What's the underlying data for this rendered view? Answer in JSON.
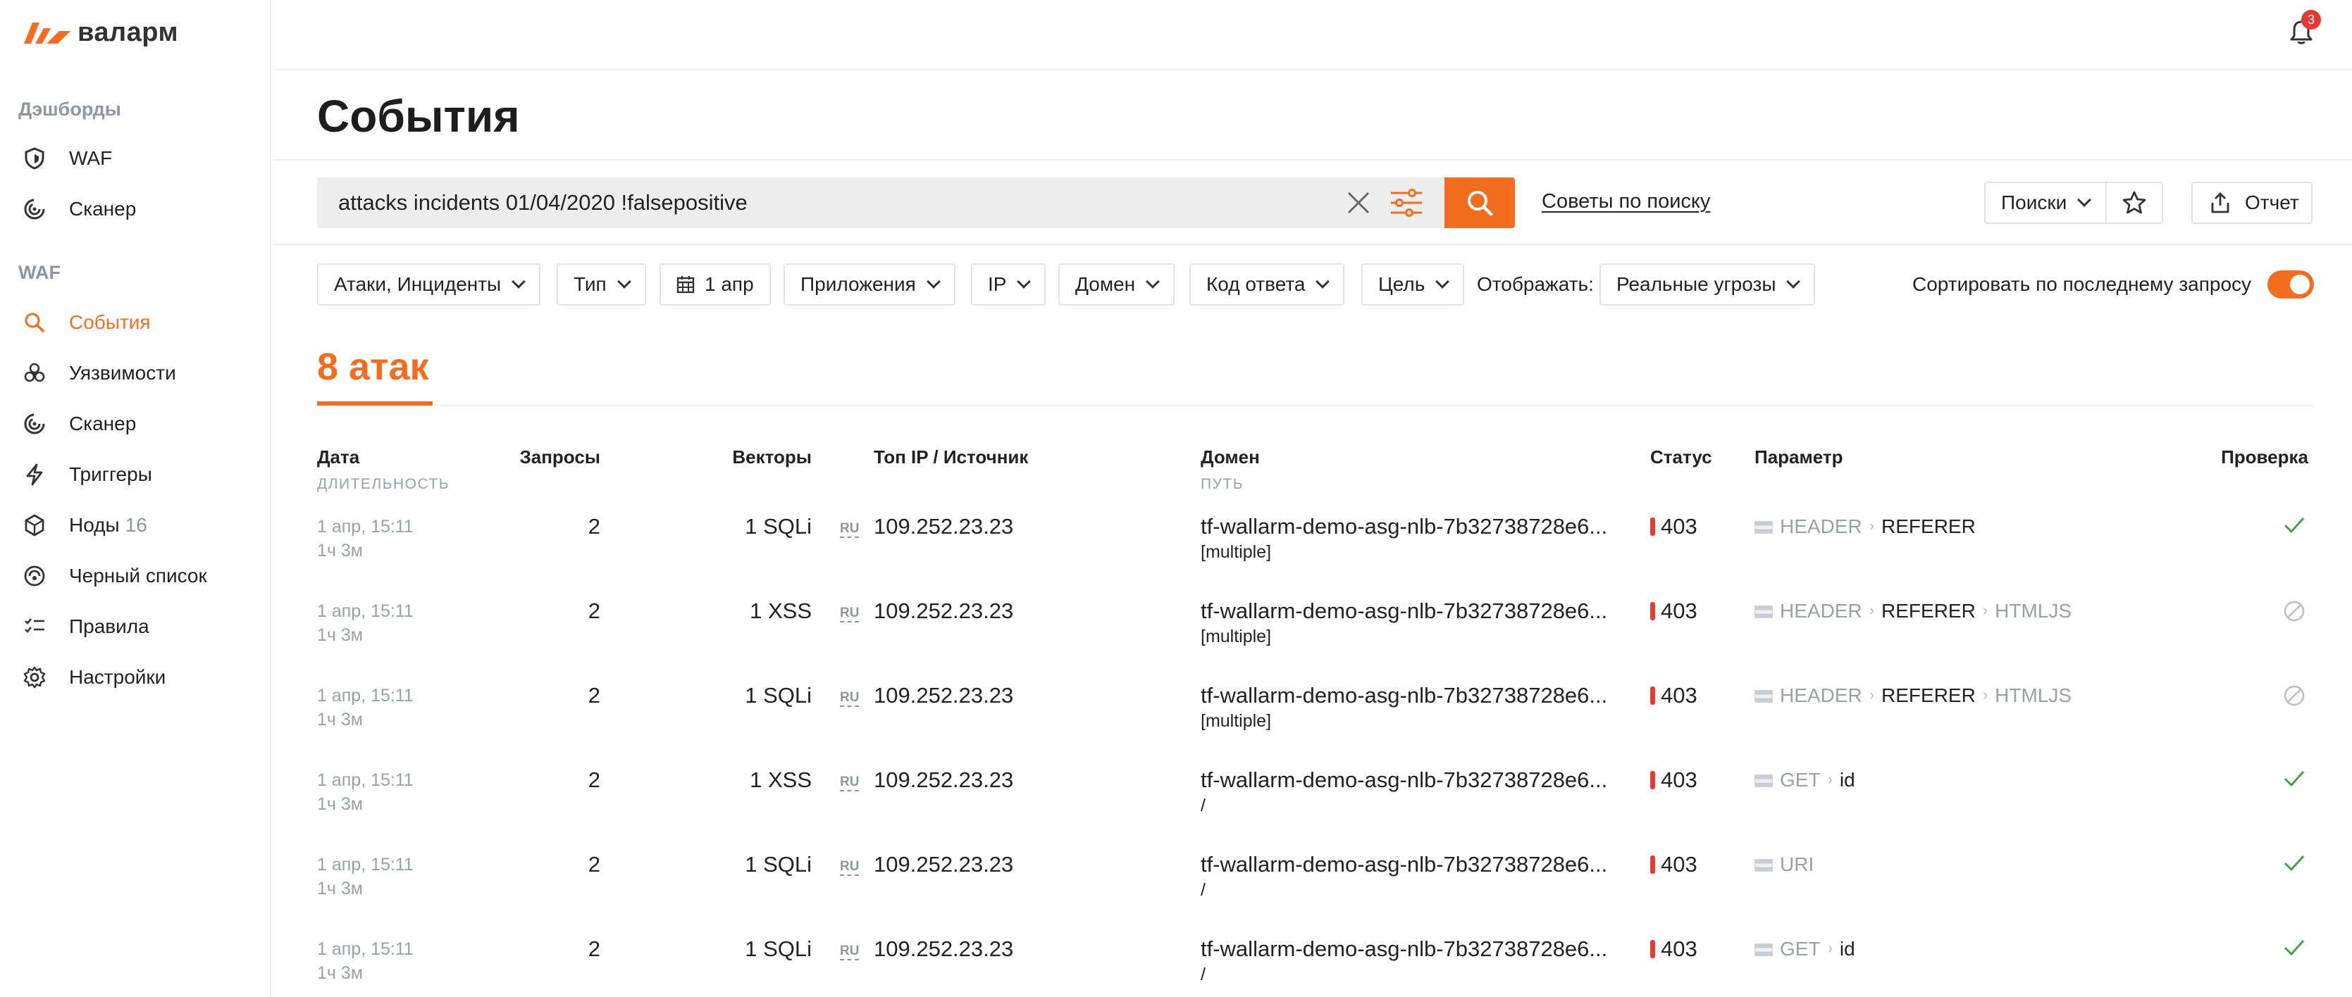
{
  "app": {
    "logo_text": "валарм"
  },
  "sidebar": {
    "sections": [
      {
        "title": "Дэшборды"
      },
      {
        "title": "WAF"
      }
    ],
    "dashboards": [
      {
        "label": "WAF",
        "icon": "shield-icon"
      },
      {
        "label": "Сканер",
        "icon": "scanner-icon"
      }
    ],
    "waf": [
      {
        "label": "События",
        "icon": "search-icon",
        "active": true
      },
      {
        "label": "Уязвимости",
        "icon": "biohazard-icon"
      },
      {
        "label": "Сканер",
        "icon": "scanner-icon"
      },
      {
        "label": "Триггеры",
        "icon": "lightning-icon"
      },
      {
        "label": "Ноды",
        "count": "16",
        "icon": "node-icon"
      },
      {
        "label": "Черный список",
        "icon": "blacklist-icon"
      },
      {
        "label": "Правила",
        "icon": "rules-icon"
      },
      {
        "label": "Настройки",
        "icon": "gear-icon"
      }
    ]
  },
  "header": {
    "notifications_count": "3"
  },
  "page": {
    "title": "События"
  },
  "search": {
    "query": "attacks incidents 01/04/2020 !falsepositive",
    "tips_label": "Советы по поиску",
    "searches_label": "Поиски",
    "report_label": "Отчет"
  },
  "filters": {
    "items": [
      {
        "label": "Атаки, Инциденты"
      },
      {
        "label": "Тип"
      },
      {
        "label": "1 апр"
      },
      {
        "label": "Приложения"
      },
      {
        "label": "IP"
      },
      {
        "label": "Домен"
      },
      {
        "label": "Код ответа"
      },
      {
        "label": "Цель"
      }
    ],
    "show_label": "Отображать:",
    "show_value": "Реальные угрозы",
    "sort_label": "Сортировать по последнему запросу",
    "sort_enabled": true
  },
  "summary": {
    "count_title": "8 атак"
  },
  "table": {
    "headers": {
      "date": "Дата",
      "date_sub": "ДЛИТЕЛЬНОСТЬ",
      "requests": "Запросы",
      "vectors": "Векторы",
      "top_ip": "Топ IP / Источник",
      "domain": "Домен",
      "domain_sub": "ПУТЬ",
      "status": "Статус",
      "param": "Параметр",
      "check": "Проверка"
    },
    "rows": [
      {
        "date": "1 апр, 15:11",
        "duration": "1ч 3м",
        "requests": "2",
        "vectors": "1 SQLi",
        "country": "RU",
        "ip": "109.252.23.23",
        "domain": "tf-wallarm-demo-asg-nlb-7b32738728e6...",
        "path": "[multiple]",
        "status": "403",
        "param": [
          "HEADER",
          "REFERER"
        ],
        "check": "verified"
      },
      {
        "date": "1 апр, 15:11",
        "duration": "1ч 3м",
        "requests": "2",
        "vectors": "1 XSS",
        "country": "RU",
        "ip": "109.252.23.23",
        "domain": "tf-wallarm-demo-asg-nlb-7b32738728e6...",
        "path": "[multiple]",
        "status": "403",
        "param": [
          "HEADER",
          "REFERER",
          "HTMLJS"
        ],
        "check": "disabled"
      },
      {
        "date": "1 апр, 15:11",
        "duration": "1ч 3м",
        "requests": "2",
        "vectors": "1 SQLi",
        "country": "RU",
        "ip": "109.252.23.23",
        "domain": "tf-wallarm-demo-asg-nlb-7b32738728e6...",
        "path": "[multiple]",
        "status": "403",
        "param": [
          "HEADER",
          "REFERER",
          "HTMLJS"
        ],
        "check": "disabled"
      },
      {
        "date": "1 апр, 15:11",
        "duration": "1ч 3м",
        "requests": "2",
        "vectors": "1 XSS",
        "country": "RU",
        "ip": "109.252.23.23",
        "domain": "tf-wallarm-demo-asg-nlb-7b32738728e6...",
        "path": "/",
        "status": "403",
        "param": [
          "GET",
          "id"
        ],
        "check": "verified"
      },
      {
        "date": "1 апр, 15:11",
        "duration": "1ч 3м",
        "requests": "2",
        "vectors": "1 SQLi",
        "country": "RU",
        "ip": "109.252.23.23",
        "domain": "tf-wallarm-demo-asg-nlb-7b32738728e6...",
        "path": "/",
        "status": "403",
        "param": [
          "URI"
        ],
        "check": "verified"
      },
      {
        "date": "1 апр, 15:11",
        "duration": "1ч 3м",
        "requests": "2",
        "vectors": "1 SQLi",
        "country": "RU",
        "ip": "109.252.23.23",
        "domain": "tf-wallarm-demo-asg-nlb-7b32738728e6...",
        "path": "/",
        "status": "403",
        "param": [
          "GET",
          "id"
        ],
        "check": "verified"
      }
    ]
  },
  "colors": {
    "accent": "#f36d21",
    "danger": "#e53935",
    "success": "#43a047"
  }
}
